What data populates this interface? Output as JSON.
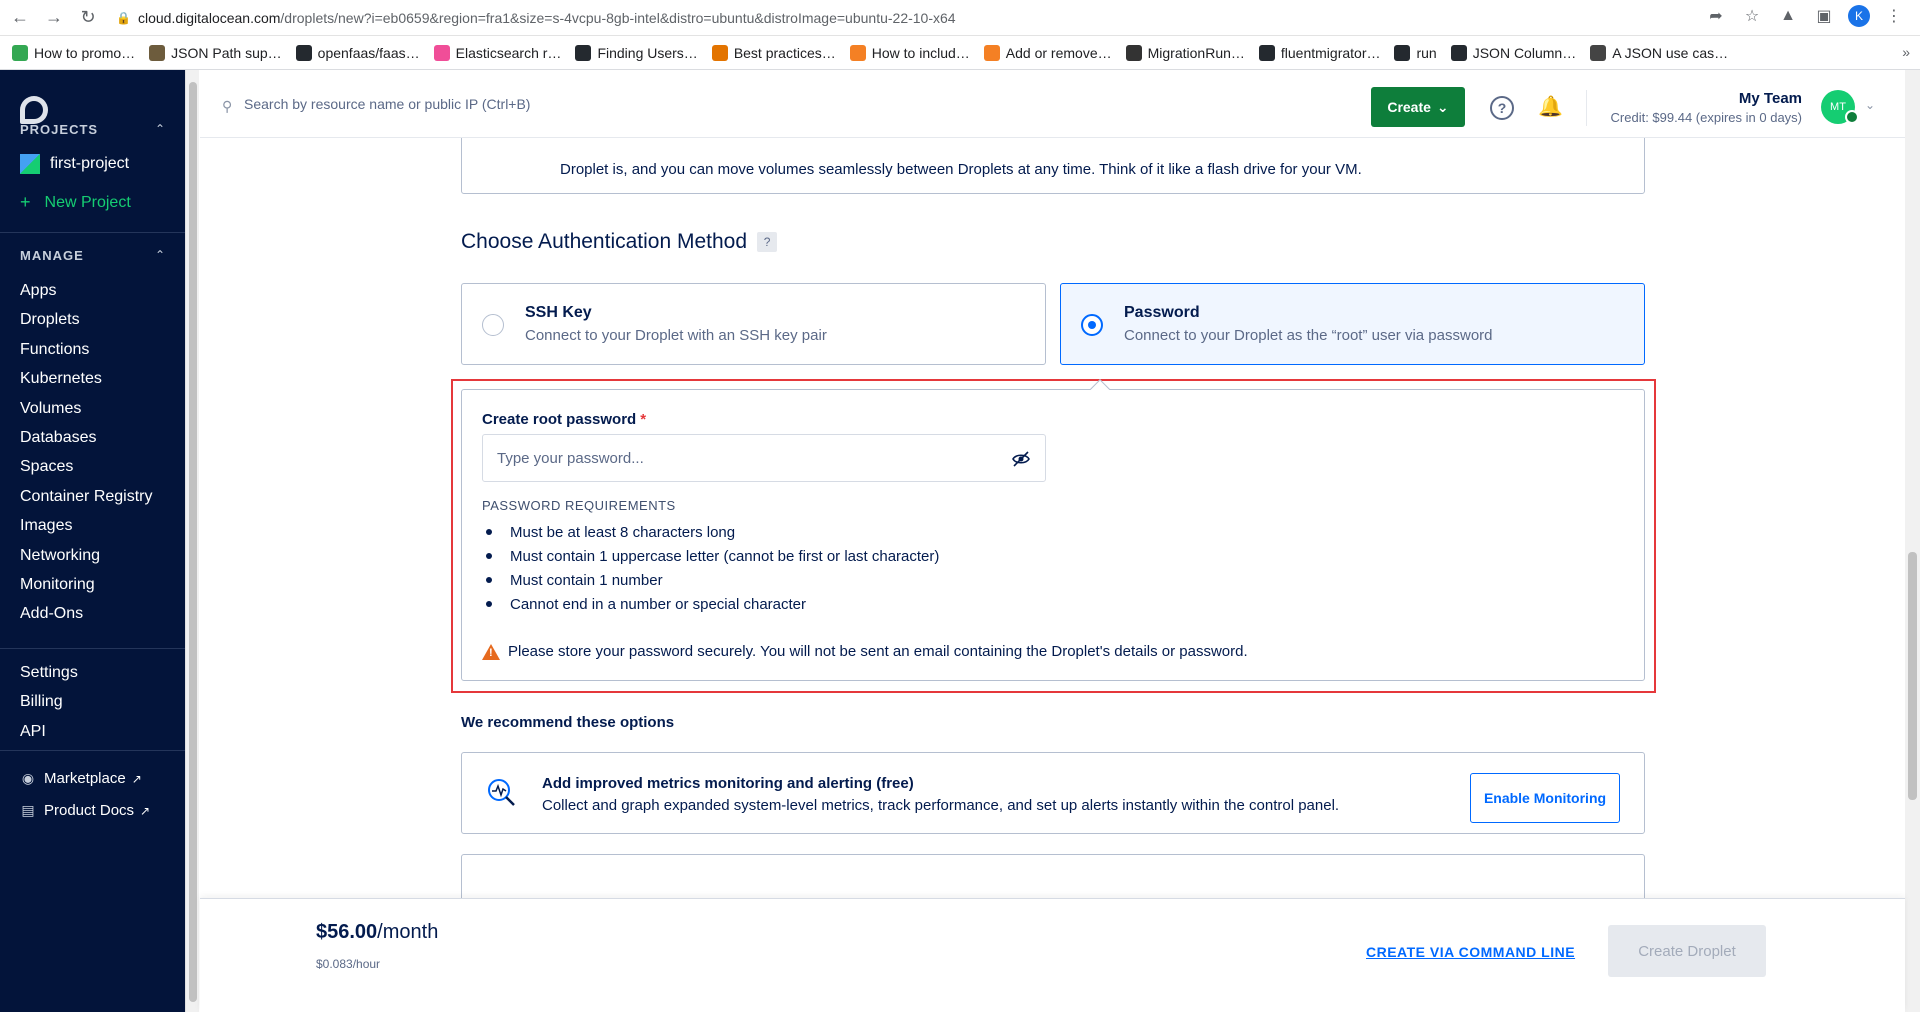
{
  "browser": {
    "url_host": "cloud.digitalocean.com",
    "url_path": "/droplets/new?i=eb0659&region=fra1&size=s-4vcpu-8gb-intel&distro=ubuntu&distroImage=ubuntu-22-10-x64",
    "profile_initial": "K",
    "bookmarks": [
      {
        "label": "How to promo…",
        "color": "#34a853"
      },
      {
        "label": "JSON Path sup…",
        "color": "#6d5c3d"
      },
      {
        "label": "openfaas/faas…",
        "color": "#24292f"
      },
      {
        "label": "Elasticsearch r…",
        "color": "#f04e98"
      },
      {
        "label": "Finding Users…",
        "color": "#24292f"
      },
      {
        "label": "Best practices…",
        "color": "#e37400"
      },
      {
        "label": "How to includ…",
        "color": "#f48024"
      },
      {
        "label": "Add or remove…",
        "color": "#f48024"
      },
      {
        "label": "MigrationRun…",
        "color": "#333333"
      },
      {
        "label": "fluentmigrator…",
        "color": "#24292f"
      },
      {
        "label": "run",
        "color": "#24292f"
      },
      {
        "label": "JSON Column…",
        "color": "#24292f"
      },
      {
        "label": "A JSON use cas…",
        "color": "#444444"
      }
    ]
  },
  "sidebar": {
    "projects_heading": "PROJECTS",
    "project_name": "first-project",
    "new_project": "New Project",
    "manage_heading": "MANAGE",
    "manage_items": [
      "Apps",
      "Droplets",
      "Functions",
      "Kubernetes",
      "Volumes",
      "Databases",
      "Spaces",
      "Container Registry",
      "Images",
      "Networking",
      "Monitoring",
      "Add-Ons"
    ],
    "account_items": [
      "Settings",
      "Billing",
      "API"
    ],
    "marketplace": "Marketplace",
    "product_docs": "Product Docs"
  },
  "header": {
    "search_placeholder": "Search by resource name or public IP (Ctrl+B)",
    "create_label": "Create",
    "team_name": "My Team",
    "credit": "Credit: $99.44 (expires in 0 days)",
    "avatar_initials": "MT"
  },
  "volume_card": {
    "text": "Droplet is, and you can move volumes seamlessly between Droplets at any time. Think of it like a flash drive for your VM."
  },
  "auth": {
    "title": "Choose Authentication Method",
    "help": "?",
    "options": [
      {
        "title": "SSH Key",
        "desc": "Connect to your Droplet with an SSH key pair",
        "selected": false
      },
      {
        "title": "Password",
        "desc": "Connect to your Droplet as the “root” user via password",
        "selected": true
      }
    ],
    "password_label": "Create root password",
    "required_mark": "*",
    "password_placeholder": "Type your password...",
    "requirements_title": "PASSWORD REQUIREMENTS",
    "requirements": [
      "Must be at least 8 characters long",
      "Must contain 1 uppercase letter (cannot be first or last character)",
      "Must contain 1 number",
      "Cannot end in a number or special character"
    ],
    "warning": "Please store your password securely. You will not be sent an email containing the Droplet's details or password."
  },
  "recommend": {
    "title": "We recommend these options",
    "monitoring_title": "Add improved metrics monitoring and alerting (free)",
    "monitoring_desc": "Collect and graph expanded system-level metrics, track performance, and set up alerts instantly within the control panel.",
    "monitoring_button": "Enable Monitoring"
  },
  "footer": {
    "price": "$56.00",
    "per": "/month",
    "hourly": "$0.083/hour",
    "cli_link": "CREATE VIA COMMAND LINE",
    "create_button": "Create Droplet"
  },
  "colors": {
    "sidebar_bg": "#03143a",
    "accent_blue": "#0069ff",
    "create_green": "#0e7e3b",
    "highlight_red": "#e5383b",
    "warning_orange": "#e66a1f"
  }
}
